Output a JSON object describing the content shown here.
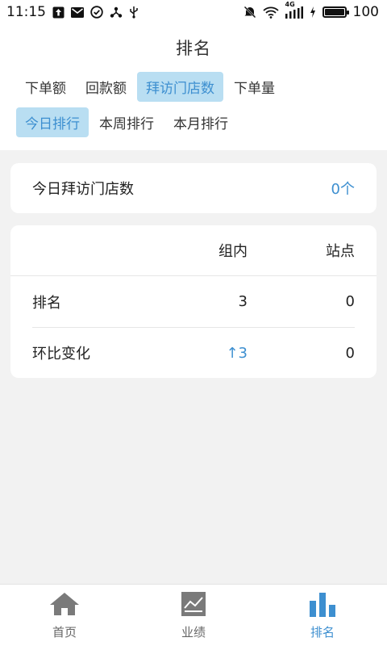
{
  "status_bar": {
    "time": "11:15",
    "network": "4G",
    "battery": "100",
    "icons_left": [
      "upload-icon",
      "mail-icon",
      "check-circle-icon",
      "share-icon",
      "usb-icon"
    ],
    "icons_right": [
      "mute-icon",
      "wifi-icon",
      "signal-icon",
      "charging-icon",
      "battery-icon"
    ]
  },
  "header": {
    "title": "排名"
  },
  "metric_tabs": [
    {
      "label": "下单额",
      "active": false
    },
    {
      "label": "回款额",
      "active": false
    },
    {
      "label": "拜访门店数",
      "active": true
    },
    {
      "label": "下单量",
      "active": false
    }
  ],
  "period_tabs": [
    {
      "label": "今日排行",
      "active": true
    },
    {
      "label": "本周排行",
      "active": false
    },
    {
      "label": "本月排行",
      "active": false
    }
  ],
  "summary": {
    "label": "今日拜访门店数",
    "value": "0个"
  },
  "table": {
    "columns": [
      "组内",
      "站点"
    ],
    "rows": [
      {
        "label": "排名",
        "group": "3",
        "site": "0"
      },
      {
        "label": "环比变化",
        "group_arrow": "↑",
        "group": "3",
        "site": "0"
      }
    ]
  },
  "bottom_nav": [
    {
      "label": "首页",
      "icon": "home-icon",
      "active": false
    },
    {
      "label": "业绩",
      "icon": "performance-icon",
      "active": false
    },
    {
      "label": "排名",
      "icon": "bar-chart-icon",
      "active": true
    }
  ],
  "colors": {
    "accent": "#3d8fd0",
    "active_tab_bg": "#b9def2",
    "page_bg": "#f2f2f2",
    "inactive_icon": "#7a7a7a"
  }
}
